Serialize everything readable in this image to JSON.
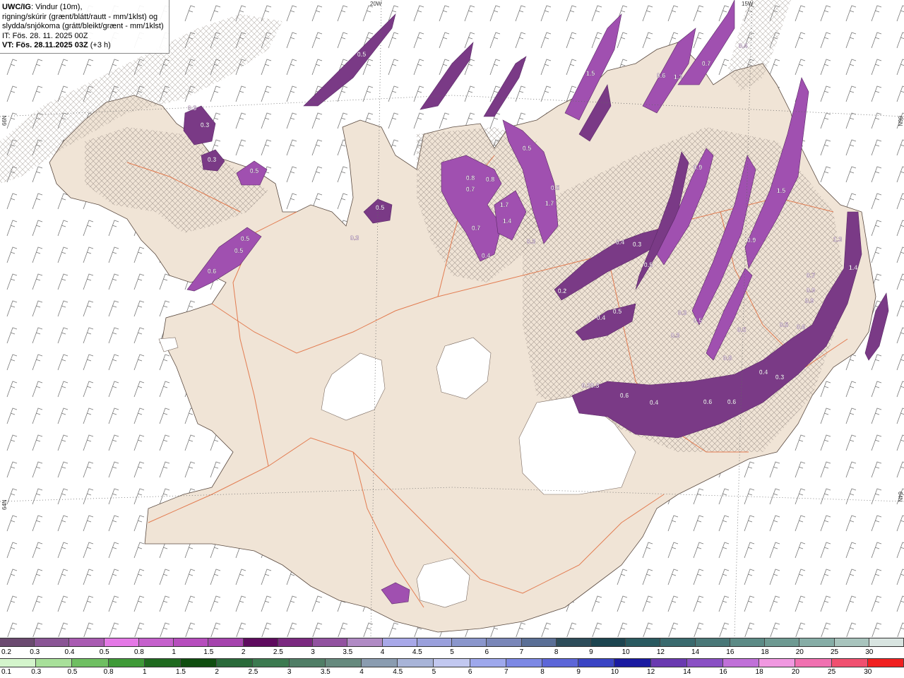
{
  "header": {
    "product": "UWC/IG",
    "line1_rest": ": Vindur (10m),",
    "line2": "rigning/skúrir (grænt/blátt/rautt - mm/1klst) og",
    "line3": "slydda/snjókoma (grátt/bleikt/grænt - mm/1klst)",
    "line4": "IT: Fös. 28. 11. 2025 00Z",
    "line5_bold": "VT: Fös. 28.11.2025 03Z",
    "line5_rest": " (+3 h)"
  },
  "graticule": {
    "top_left": "20W",
    "top_right": "15W",
    "left_upper": "66N",
    "left_lower": "64N",
    "right_upper": "66N",
    "right_lower": "64N"
  },
  "colors": {
    "land": "#f0e4d6",
    "glacier": "#ffffff",
    "road": "#e06a3a",
    "snow_light": "#bf7fc9",
    "snow_mid": "#a050b0",
    "snow_dark": "#7a3a86",
    "snow_pink": "#f080f0"
  },
  "precip_labels": [
    {
      "t": "0.5"
    },
    {
      "t": "0.3"
    },
    {
      "t": "0.3"
    },
    {
      "t": "0.3"
    },
    {
      "t": "0.5"
    },
    {
      "t": "0.5"
    },
    {
      "t": "0.3"
    },
    {
      "t": "0.5"
    },
    {
      "t": "0.5"
    },
    {
      "t": "0.6"
    },
    {
      "t": "0.8"
    },
    {
      "t": "0.7"
    },
    {
      "t": "0.8"
    },
    {
      "t": "1.7"
    },
    {
      "t": "1.4"
    },
    {
      "t": "0.7"
    },
    {
      "t": "0.4"
    },
    {
      "t": "0.5"
    },
    {
      "t": "1.7"
    },
    {
      "t": "0.9"
    },
    {
      "t": "0.5"
    },
    {
      "t": "0.3"
    },
    {
      "t": "0.4"
    },
    {
      "t": "0.3"
    },
    {
      "t": "0.5"
    },
    {
      "t": "0.2"
    },
    {
      "t": "0.4"
    },
    {
      "t": "0.5"
    },
    {
      "t": "0.30.3"
    },
    {
      "t": "0.6"
    },
    {
      "t": "0.4"
    },
    {
      "t": "0.6"
    },
    {
      "t": "0.6"
    },
    {
      "t": "0.3"
    },
    {
      "t": "0.4"
    },
    {
      "t": "0.8"
    },
    {
      "t": "0.5"
    },
    {
      "t": "0.9"
    },
    {
      "t": "1.5"
    },
    {
      "t": "1.3"
    },
    {
      "t": "1.4"
    },
    {
      "t": "0.9"
    },
    {
      "t": "0.9"
    },
    {
      "t": "0.6"
    },
    {
      "t": "0.7"
    },
    {
      "t": "1.3"
    },
    {
      "t": "0.7"
    },
    {
      "t": "1.5"
    },
    {
      "t": "0.5"
    },
    {
      "t": "0.3"
    },
    {
      "t": "0.6"
    },
    {
      "t": "0.3"
    },
    {
      "t": "0.5"
    },
    {
      "t": "0.4"
    }
  ],
  "legend_snow": {
    "labels": [
      "0.2",
      "0.3",
      "0.4",
      "0.5",
      "0.8",
      "1",
      "1.5",
      "2",
      "2.5",
      "3",
      "3.5",
      "4",
      "4.5",
      "5",
      "6",
      "7",
      "8",
      "9",
      "10",
      "12",
      "14",
      "16",
      "18",
      "20",
      "25",
      "30"
    ],
    "colors": [
      "#6b4a70",
      "#8a5595",
      "#a95bb2",
      "#e478e6",
      "#c560cc",
      "#b64dbd",
      "#a543ad",
      "#5e0b5e",
      "#7b2a80",
      "#9252a0",
      "#b08ac4",
      "#a8a8e8",
      "#9aa0dc",
      "#8a96cc",
      "#7986b8",
      "#5a6f96",
      "#2d4d5a",
      "#1d4550",
      "#2a5a60",
      "#3a6a6e",
      "#4a7878",
      "#5c8b86",
      "#6e9a92",
      "#86ada6",
      "#a8c4bd",
      "#d8e4e0"
    ]
  },
  "legend_rain": {
    "labels": [
      "0.1",
      "0.3",
      "0.5",
      "0.8",
      "1",
      "1.5",
      "2",
      "2.5",
      "3",
      "3.5",
      "4",
      "4.5",
      "5",
      "6",
      "7",
      "8",
      "9",
      "10",
      "12",
      "14",
      "16",
      "18",
      "20",
      "25",
      "30"
    ],
    "colors": [
      "#d4f5cc",
      "#a8e09a",
      "#6fbf62",
      "#3f9a38",
      "#1f6a1f",
      "#0f4d0f",
      "#2a6a3a",
      "#3c7a50",
      "#507e66",
      "#668a7e",
      "#8a9cb0",
      "#a8b4d8",
      "#c2c8f0",
      "#9ea8ec",
      "#7c88e4",
      "#5c66d8",
      "#3a44c4",
      "#1a1aa0",
      "#6a3ab0",
      "#8a50c4",
      "#c070d8",
      "#f098e0",
      "#f070b0",
      "#f05070",
      "#f02020"
    ]
  }
}
